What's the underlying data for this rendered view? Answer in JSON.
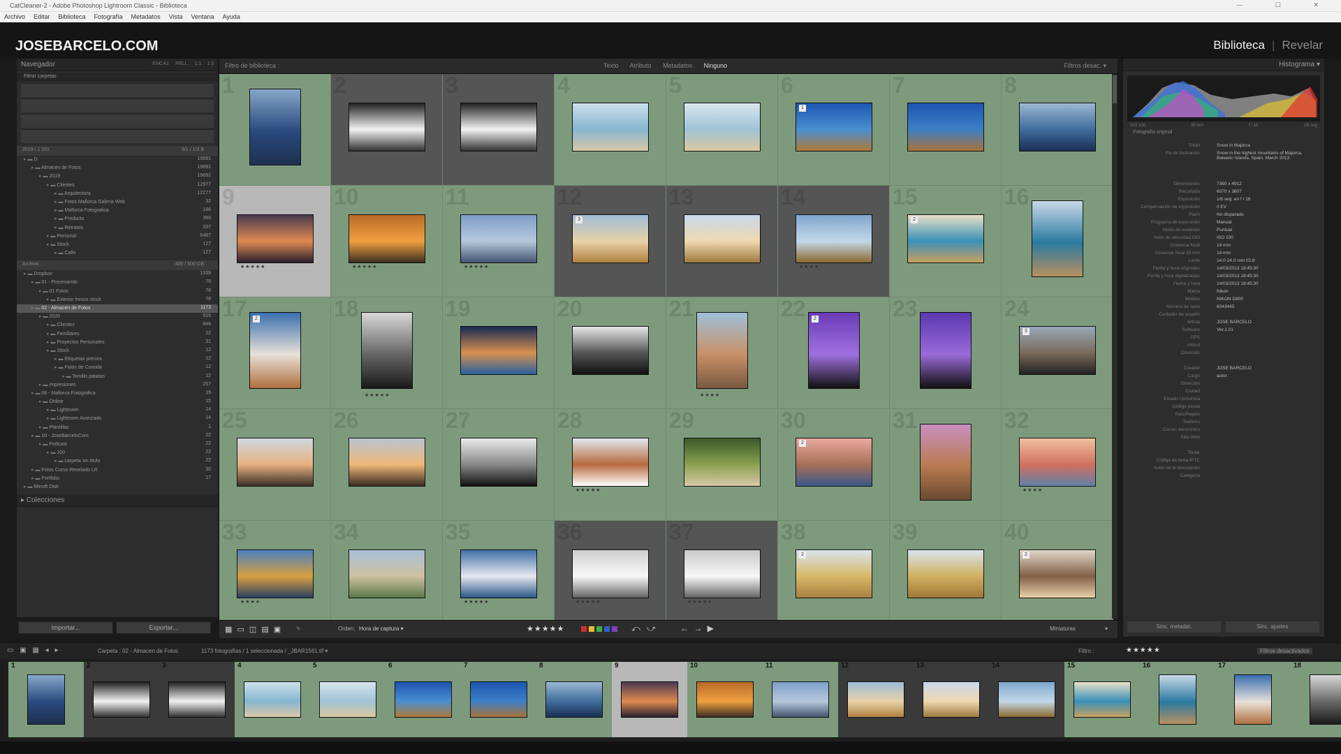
{
  "window": {
    "title": "CatCleaner-2 - Adobe Photoshop Lightroom Classic - Biblioteca",
    "controls": "— ☐ ✕"
  },
  "menu": [
    "Archivo",
    "Editar",
    "Biblioteca",
    "Fotografía",
    "Metadatos",
    "Vista",
    "Ventana",
    "Ayuda"
  ],
  "brand": "JOSEBARCELO.COM",
  "modules": {
    "library": "Biblioteca",
    "develop": "Revelar"
  },
  "left_panel": {
    "navigator": "Navegador",
    "nav_modes": [
      "ENCAJ.",
      "RELL.",
      "1:1",
      "1:3"
    ],
    "catalog_filter": "Filtrar carpetas",
    "volume1": {
      "label": "2019 / 1 201",
      "free": "6/1 / 1/3 B"
    },
    "volume2": {
      "label": "Archivo",
      "free": "400 / 500 GB"
    },
    "folders": [
      {
        "label": "D:",
        "count": "19691",
        "indent": 0
      },
      {
        "label": "Almacen de Fotos",
        "count": "19691",
        "indent": 1
      },
      {
        "label": "2019",
        "count": "19691",
        "indent": 2
      },
      {
        "label": "Clientes",
        "count": "12977",
        "indent": 3
      },
      {
        "label": "Arquitectura",
        "count": "12277",
        "indent": 4
      },
      {
        "label": "Fotos Mallorca Galeria Web",
        "count": "32",
        "indent": 4
      },
      {
        "label": "Mallorca Fotografica",
        "count": "186",
        "indent": 4
      },
      {
        "label": "Producto",
        "count": "369",
        "indent": 4
      },
      {
        "label": "Retratos",
        "count": "337",
        "indent": 4
      },
      {
        "label": "Personal",
        "count": "6487",
        "indent": 3
      },
      {
        "label": "Stock",
        "count": "127",
        "indent": 3
      },
      {
        "label": "Calle",
        "count": "127",
        "indent": 4
      }
    ],
    "folders2": [
      {
        "label": "Dropbox",
        "count": "1339",
        "indent": 0
      },
      {
        "label": "01 - Procesando",
        "count": "78",
        "indent": 1
      },
      {
        "label": "01 Fotos",
        "count": "78",
        "indent": 2
      },
      {
        "label": "Exterior fresco stock",
        "count": "78",
        "indent": 3
      },
      {
        "label": "02 - Almacen de Fotos",
        "count": "1173",
        "indent": 1,
        "selected": true
      },
      {
        "label": "2020",
        "count": "916",
        "indent": 2
      },
      {
        "label": "Clientes",
        "count": "846",
        "indent": 3
      },
      {
        "label": "Familiares",
        "count": "22",
        "indent": 3
      },
      {
        "label": "Proyectos Personales",
        "count": "31",
        "indent": 3
      },
      {
        "label": "Stock",
        "count": "12",
        "indent": 3
      },
      {
        "label": "Etiquetas precios",
        "count": "12",
        "indent": 4
      },
      {
        "label": "Fotos de Comida",
        "count": "12",
        "indent": 4
      },
      {
        "label": "Tomillo patatas",
        "count": "12",
        "indent": 5
      },
      {
        "label": "Impresiones",
        "count": "257",
        "indent": 2
      },
      {
        "label": "06 - Mallorca Fotografica",
        "count": "16",
        "indent": 1
      },
      {
        "label": "Online",
        "count": "15",
        "indent": 2
      },
      {
        "label": "Lightroom",
        "count": "14",
        "indent": 3
      },
      {
        "label": "Lightroom Avanzado",
        "count": "14",
        "indent": 3
      },
      {
        "label": "Plantillas",
        "count": "1",
        "indent": 2
      },
      {
        "label": "10 - JoseBarceloCom",
        "count": "22",
        "indent": 1
      },
      {
        "label": "Podcast",
        "count": "22",
        "indent": 2
      },
      {
        "label": "100",
        "count": "22",
        "indent": 3
      },
      {
        "label": "carpeta sin titulo",
        "count": "22",
        "indent": 4
      },
      {
        "label": "Fotos Curso Revelado LR",
        "count": "30",
        "indent": 1
      },
      {
        "label": "Portfolio",
        "count": "17",
        "indent": 1
      },
      {
        "label": "Mirroft Disk",
        "count": "",
        "indent": 0
      }
    ],
    "collections": "Colecciones",
    "import_btn": "Importar...",
    "export_btn": "Exportar..."
  },
  "grid": {
    "filter_title": "Filtro de biblioteca :",
    "filter_tabs": [
      "Texto",
      "Atributo",
      "Metadatos",
      "Ninguno"
    ],
    "filter_preset": "Filtros desac. ▾",
    "cells": [
      {
        "n": "1",
        "c": "green",
        "img": [
          "#87a7c9",
          "#2a4a80",
          "#1e3050"
        ],
        "o": "p"
      },
      {
        "n": "2",
        "c": "dark",
        "img": [
          "#222",
          "#f2f2f2",
          "#333"
        ],
        "o": "l"
      },
      {
        "n": "3",
        "c": "dark",
        "img": [
          "#222",
          "#f2f2f2",
          "#333"
        ],
        "o": "l"
      },
      {
        "n": "4",
        "c": "green",
        "img": [
          "#cde0ec",
          "#86b6cf",
          "#d9c9a8"
        ],
        "o": "l"
      },
      {
        "n": "5",
        "c": "green",
        "img": [
          "#d8e6ee",
          "#9fc3d6",
          "#dcc8a0"
        ],
        "o": "l"
      },
      {
        "n": "6",
        "c": "",
        "img": [
          "#1c55b0",
          "#4a8fd0",
          "#b07a38"
        ],
        "o": "l",
        "b": "1"
      },
      {
        "n": "7",
        "c": "",
        "img": [
          "#1c55b0",
          "#3d7fc6",
          "#a8733a"
        ],
        "o": "l"
      },
      {
        "n": "8",
        "c": "green",
        "img": [
          "#9cb8d4",
          "#3f6d9c",
          "#1b2f55"
        ],
        "o": "l"
      },
      {
        "n": "9",
        "c": "sel",
        "img": [
          "#4a3a50",
          "#e08a50",
          "#2a2030"
        ],
        "o": "l",
        "st": "★★★★★"
      },
      {
        "n": "10",
        "c": "green",
        "img": [
          "#b86a28",
          "#f0a040",
          "#3a2e22"
        ],
        "o": "l",
        "st": "★★★★★"
      },
      {
        "n": "11",
        "c": "green",
        "img": [
          "#7e9ec8",
          "#b6c8dc",
          "#445570"
        ],
        "o": "l",
        "st": "★★★★★"
      },
      {
        "n": "12",
        "c": "dark",
        "img": [
          "#9fbcd8",
          "#e8d2a8",
          "#b08040"
        ],
        "o": "l",
        "b": "3"
      },
      {
        "n": "13",
        "c": "dark",
        "img": [
          "#c8d8ea",
          "#f0d8b0",
          "#9c7a40"
        ],
        "o": "l"
      },
      {
        "n": "14",
        "c": "dark",
        "img": [
          "#7fa6cc",
          "#c2d8ea",
          "#8a6a30"
        ],
        "o": "l",
        "st": "★★★★"
      },
      {
        "n": "15",
        "c": "green",
        "img": [
          "#e8e0c8",
          "#3a90b8",
          "#c8a060"
        ],
        "o": "l",
        "b": "2"
      },
      {
        "n": "16",
        "c": "green",
        "img": [
          "#c8d8e8",
          "#2a7aa0",
          "#b89060"
        ],
        "o": "p"
      },
      {
        "n": "17",
        "c": "green",
        "img": [
          "#3a6fb0",
          "#e8e0d8",
          "#b07040"
        ],
        "o": "p",
        "b": "2"
      },
      {
        "n": "18",
        "c": "green",
        "img": [
          "#d8d8d8",
          "#666",
          "#1a1a1a"
        ],
        "o": "p",
        "st": "★★★★★"
      },
      {
        "n": "19",
        "c": "green",
        "img": [
          "#1a2a55",
          "#d89050",
          "#2a60a0"
        ],
        "o": "l"
      },
      {
        "n": "20",
        "c": "green",
        "img": [
          "#e8e8e8",
          "#555",
          "#111"
        ],
        "o": "l"
      },
      {
        "n": "21",
        "c": "green",
        "img": [
          "#9fc0d8",
          "#c89068",
          "#7a5a40"
        ],
        "o": "p",
        "st": "★★★★"
      },
      {
        "n": "22",
        "c": "green",
        "img": [
          "#6a3ab8",
          "#a070e0",
          "#111"
        ],
        "o": "p",
        "b": "2"
      },
      {
        "n": "23",
        "c": "green",
        "img": [
          "#5a38b0",
          "#9a6ad8",
          "#111"
        ],
        "o": "p"
      },
      {
        "n": "24",
        "c": "green",
        "img": [
          "#98a8b8",
          "#7a6a5a",
          "#222"
        ],
        "o": "l",
        "b": "3"
      },
      {
        "n": "25",
        "c": "green",
        "img": [
          "#cfd8e0",
          "#e8b080",
          "#3a3028"
        ],
        "o": "l"
      },
      {
        "n": "26",
        "c": "green",
        "img": [
          "#b8c4d0",
          "#f0b878",
          "#3a2c22"
        ],
        "o": "l"
      },
      {
        "n": "27",
        "c": "green",
        "img": [
          "#eaeaea",
          "#888",
          "#111"
        ],
        "o": "l"
      },
      {
        "n": "28",
        "c": "green",
        "img": [
          "#e0e8ee",
          "#b86a40",
          "#fff"
        ],
        "o": "l",
        "st": "★★★★★"
      },
      {
        "n": "29",
        "c": "green",
        "img": [
          "#3a5a2a",
          "#8aa050",
          "#d8c8a8"
        ],
        "o": "l"
      },
      {
        "n": "30",
        "c": "green",
        "img": [
          "#e8a8a0",
          "#a87058",
          "#3a5888"
        ],
        "o": "l",
        "b": "2"
      },
      {
        "n": "31",
        "c": "green",
        "img": [
          "#c890c0",
          "#b87a50",
          "#6a4a30"
        ],
        "o": "p"
      },
      {
        "n": "32",
        "c": "green",
        "img": [
          "#f0c0a0",
          "#d07060",
          "#6080a8"
        ],
        "o": "l",
        "st": "★★★★"
      },
      {
        "n": "33",
        "c": "green",
        "img": [
          "#4a80c0",
          "#d8a040",
          "#2a4060"
        ],
        "o": "l",
        "st": "★★★★"
      },
      {
        "n": "34",
        "c": "green",
        "img": [
          "#a8c0d8",
          "#d0c0a0",
          "#5a7a4a"
        ],
        "o": "l"
      },
      {
        "n": "35",
        "c": "green",
        "img": [
          "#4070a8",
          "#e8e8f0",
          "#2a5888"
        ],
        "o": "l",
        "st": "★★★★★"
      },
      {
        "n": "36",
        "c": "dark",
        "img": [
          "#cfcfcf",
          "#f8f8f8",
          "#666"
        ],
        "o": "l",
        "st": "★★★★★"
      },
      {
        "n": "37",
        "c": "dark",
        "img": [
          "#c8c8c8",
          "#f8f8f8",
          "#666"
        ],
        "o": "l",
        "st": "★★★★★"
      },
      {
        "n": "38",
        "c": "green",
        "img": [
          "#d8e4ec",
          "#d8b868",
          "#a88040"
        ],
        "o": "l",
        "b": "2"
      },
      {
        "n": "39",
        "c": "green",
        "img": [
          "#d8e4ec",
          "#d0b060",
          "#a07838"
        ],
        "o": "l"
      },
      {
        "n": "40",
        "c": "green",
        "img": [
          "#e0d8c8",
          "#806048",
          "#e8d0a8"
        ],
        "o": "l",
        "b": "2"
      }
    ]
  },
  "toolbar": {
    "sort_label": "Orden:",
    "sort_value": "Hora de captura ▾",
    "stars": "★★★★★",
    "flag_colors": [
      "#d03030",
      "#e0c030",
      "#40b040",
      "#3060d0",
      "#8040c0"
    ],
    "thumbs_label": "Miniaturas"
  },
  "right_panel": {
    "histogram": "Histograma ▾",
    "hist_info": [
      "ISO 100",
      "35 mm",
      "f / 16",
      "1/6 seg"
    ],
    "original": "Fotografía original",
    "meta": [
      [
        "Título",
        "Snow in Majorca"
      ],
      [
        "Pie de ilustración",
        "Snow in the highest mountains of Majorca, Balearic Islands, Spain. March 2013"
      ],
      [
        "",
        ""
      ],
      [
        "Dimensiones",
        "7360 x 4912"
      ],
      [
        "Recortada",
        "6070 x 3807"
      ],
      [
        "Exposición",
        "1/6 seg. en f / 16"
      ],
      [
        "Compensación de exposición",
        "0 EV"
      ],
      [
        "Flash",
        "No disparado"
      ],
      [
        "Programa de exposición",
        "Manual"
      ],
      [
        "Modo de medición",
        "Puntual"
      ],
      [
        "Valor de velocidad ISO",
        "ISO 100"
      ],
      [
        "Distancia focal",
        "14 mm"
      ],
      [
        "Distancia focal 35 mm",
        "14 mm"
      ],
      [
        "Lente",
        "14.0-24.0 mm f/2.8"
      ],
      [
        "Fecha y hora originales",
        "14/03/2013 18:45:30"
      ],
      [
        "Fecha y hora digitalizadas",
        "14/03/2013 18:45:30"
      ],
      [
        "Fecha y hora",
        "14/03/2013 18:45:30"
      ],
      [
        "Marca",
        "Nikon"
      ],
      [
        "Modelo",
        "NIKON D800"
      ],
      [
        "Número de serie",
        "6043445"
      ],
      [
        "Contador de usuario",
        ""
      ],
      [
        "Artista",
        "JOSE BARCELO"
      ],
      [
        "Software",
        "Ver.1.01"
      ],
      [
        "GPS",
        ""
      ],
      [
        "Altitud",
        ""
      ],
      [
        "Dirección",
        ""
      ],
      [
        "",
        ""
      ],
      [
        "Creador",
        "JOSE BARCELO"
      ],
      [
        "Cargo",
        "autor"
      ],
      [
        "Dirección",
        ""
      ],
      [
        "Ciudad",
        ""
      ],
      [
        "Estado / provincia",
        ""
      ],
      [
        "Código postal",
        ""
      ],
      [
        "País/Región",
        ""
      ],
      [
        "Teléfono",
        ""
      ],
      [
        "Correo electrónico",
        ""
      ],
      [
        "Sitio Web",
        ""
      ],
      [
        "",
        ""
      ],
      [
        "Titular",
        ""
      ],
      [
        "Código de tema IPTC",
        ""
      ],
      [
        "Autor de la descripción",
        ""
      ],
      [
        "Categoría",
        ""
      ]
    ],
    "sync_meta": "Sinc. metadat.",
    "sync_settings": "Sinc. ajustes"
  },
  "filmstrip": {
    "breadcrumb": "Carpeta : 02 - Almacen de Fotos",
    "count": "1173 fotografías / 1 seleccionada / _JBAR1561.tif ▾",
    "filter_label": "Filtro :",
    "filter_value": "Filtros desactivados",
    "thumbs": [
      {
        "n": "1",
        "c": "green",
        "img": [
          "#87a7c9",
          "#2a4a80",
          "#1e3050"
        ],
        "o": "p"
      },
      {
        "n": "2",
        "c": "",
        "img": [
          "#222",
          "#f2f2f2",
          "#333"
        ],
        "o": "l"
      },
      {
        "n": "3",
        "c": "",
        "img": [
          "#222",
          "#f2f2f2",
          "#333"
        ],
        "o": "l"
      },
      {
        "n": "4",
        "c": "green",
        "img": [
          "#cde0ec",
          "#86b6cf",
          "#d9c9a8"
        ],
        "o": "l"
      },
      {
        "n": "5",
        "c": "green",
        "img": [
          "#d8e6ee",
          "#9fc3d6",
          "#dcc8a0"
        ],
        "o": "l"
      },
      {
        "n": "6",
        "c": "green",
        "img": [
          "#1c55b0",
          "#4a8fd0",
          "#b07a38"
        ],
        "o": "l"
      },
      {
        "n": "7",
        "c": "green",
        "img": [
          "#1c55b0",
          "#3d7fc6",
          "#a8733a"
        ],
        "o": "l"
      },
      {
        "n": "8",
        "c": "green",
        "img": [
          "#9cb8d4",
          "#3f6d9c",
          "#1b2f55"
        ],
        "o": "l"
      },
      {
        "n": "9",
        "c": "sel",
        "img": [
          "#4a3a50",
          "#e08a50",
          "#2a2030"
        ],
        "o": "l"
      },
      {
        "n": "10",
        "c": "green",
        "img": [
          "#b86a28",
          "#f0a040",
          "#3a2e22"
        ],
        "o": "l"
      },
      {
        "n": "11",
        "c": "green",
        "img": [
          "#7e9ec8",
          "#b6c8dc",
          "#445570"
        ],
        "o": "l"
      },
      {
        "n": "12",
        "c": "",
        "img": [
          "#9fbcd8",
          "#e8d2a8",
          "#b08040"
        ],
        "o": "l"
      },
      {
        "n": "13",
        "c": "",
        "img": [
          "#c8d8ea",
          "#f0d8b0",
          "#9c7a40"
        ],
        "o": "l"
      },
      {
        "n": "14",
        "c": "",
        "img": [
          "#7fa6cc",
          "#c2d8ea",
          "#8a6a30"
        ],
        "o": "l"
      },
      {
        "n": "15",
        "c": "green",
        "img": [
          "#e8e0c8",
          "#3a90b8",
          "#c8a060"
        ],
        "o": "l"
      },
      {
        "n": "16",
        "c": "green",
        "img": [
          "#c8d8e8",
          "#2a7aa0",
          "#b89060"
        ],
        "o": "p"
      },
      {
        "n": "17",
        "c": "green",
        "img": [
          "#3a6fb0",
          "#e8e0d8",
          "#b07040"
        ],
        "o": "p"
      },
      {
        "n": "18",
        "c": "green",
        "img": [
          "#d8d8d8",
          "#666",
          "#1a1a1a"
        ],
        "o": "p"
      }
    ]
  }
}
